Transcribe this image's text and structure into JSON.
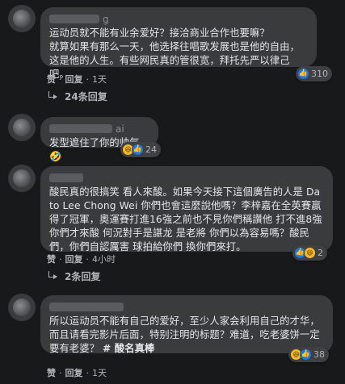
{
  "comments": [
    {
      "author_tail": "g",
      "text": "运动员就不能有业余爱好？接洽商业合作也要嘛？\n就算如果有那么一天，他选择往唱歌发展也是他的自由，这是他的人生。有些网民真的管很宽，拜托先严以律己吧。",
      "reaction_count": "310",
      "reactions": [
        "like"
      ],
      "actions": {
        "like": "赞",
        "reply": "回复",
        "time": "1天"
      },
      "replies_label": "24条回复"
    },
    {
      "author_tail": "ai",
      "text": "发型遮住了你的帅气🤣",
      "reaction_count": "24",
      "reactions": [
        "haha",
        "like"
      ]
    },
    {
      "author_tail": "",
      "text": "酸民真的很搞笑 看人來酸。如果今天接下這個廣告的人是 Dato Lee Chong Wei 你們也會這麼說他嗎？李梓嘉在全英賽贏得了冠軍，奧運賽打進16強之前也不見你們稱讚他 打不進8強你們才來酸 何況對手是諶龙 是老將 你們以為容易嗎？酸民們，你們自認厲害 球拍給你們 換你們來打。",
      "reaction_count": "2",
      "reactions": [
        "like",
        "haha"
      ],
      "actions": {
        "like": "赞",
        "reply": "回复",
        "time": "4小时"
      },
      "replies_label": "2条回复"
    },
    {
      "author_tail": "",
      "text": "所以运动员不能有自己的爱好，至少人家会利用自己的才华，而且请看完影片后面，特别注明的标题？难道，吃老婆饼一定要有老婆？ ",
      "text_bold": "# 酸名真棒",
      "reaction_count": "38",
      "reactions": [
        "haha",
        "like"
      ],
      "actions": {
        "like": "赞",
        "reply": "回复",
        "time": "1天"
      }
    }
  ],
  "colors": {
    "background": "#18191a",
    "bubble": "#3a3b3c",
    "text": "#e4e6eb",
    "secondary": "#b0b3b8",
    "like_blue": "#1877f2"
  }
}
